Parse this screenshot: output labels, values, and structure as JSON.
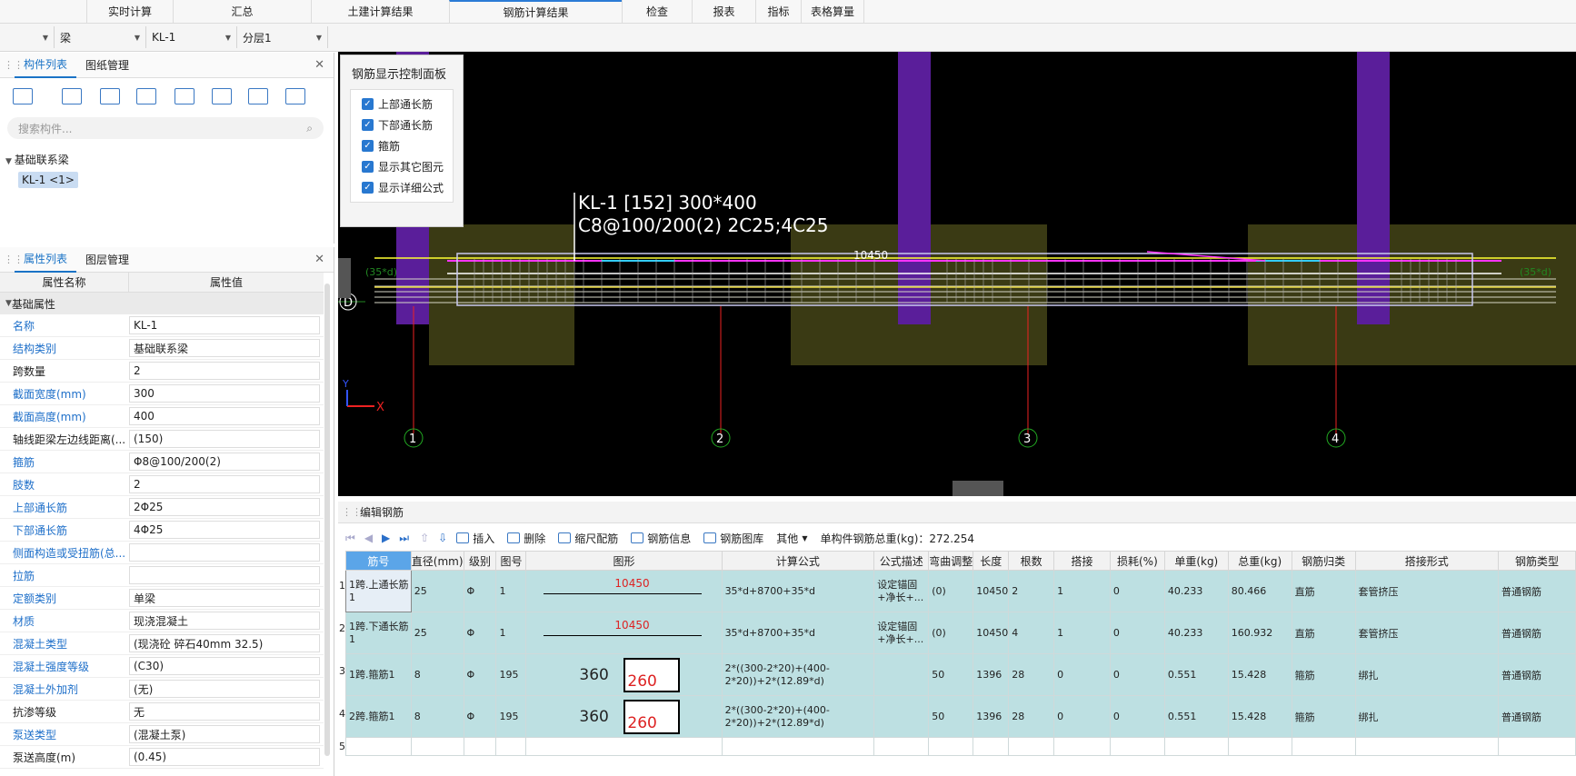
{
  "menu": [
    "实时计算",
    "汇总",
    "土建计算结果",
    "钢筋计算结果",
    "检查",
    "报表",
    "指标",
    "表格算量"
  ],
  "selectors": {
    "type": "梁",
    "member": "KL-1",
    "layer": "分层1"
  },
  "component_panel": {
    "tabs": [
      "构件列表",
      "图纸管理"
    ],
    "search_placeholder": "搜索构件...",
    "group": "基础联系梁",
    "item": "KL-1 <1>"
  },
  "property_panel": {
    "tabs": [
      "属性列表",
      "图层管理"
    ],
    "col_name": "属性名称",
    "col_value": "属性值",
    "section": "基础属性",
    "rows": [
      {
        "name": "名称",
        "value": "KL-1",
        "blue": true
      },
      {
        "name": "结构类别",
        "value": "基础联系梁",
        "blue": true
      },
      {
        "name": "跨数量",
        "value": "2",
        "blue": false
      },
      {
        "name": "截面宽度(mm)",
        "value": "300",
        "blue": true
      },
      {
        "name": "截面高度(mm)",
        "value": "400",
        "blue": true
      },
      {
        "name": "轴线距梁左边线距离(...",
        "value": "(150)",
        "blue": false
      },
      {
        "name": "箍筋",
        "value": "Φ8@100/200(2)",
        "blue": true
      },
      {
        "name": "肢数",
        "value": "2",
        "blue": true
      },
      {
        "name": "上部通长筋",
        "value": "2Φ25",
        "blue": true
      },
      {
        "name": "下部通长筋",
        "value": "4Φ25",
        "blue": true
      },
      {
        "name": "侧面构造或受扭筋(总...",
        "value": "",
        "blue": true
      },
      {
        "name": "拉筋",
        "value": "",
        "blue": true
      },
      {
        "name": "定额类别",
        "value": "单梁",
        "blue": true
      },
      {
        "name": "材质",
        "value": "现浇混凝土",
        "blue": true
      },
      {
        "name": "混凝土类型",
        "value": "(现浇砼 碎石40mm 32.5)",
        "blue": true
      },
      {
        "name": "混凝土强度等级",
        "value": "(C30)",
        "blue": true
      },
      {
        "name": "混凝土外加剂",
        "value": "(无)",
        "blue": true
      },
      {
        "name": "抗渗等级",
        "value": "无",
        "blue": false
      },
      {
        "name": "泵送类型",
        "value": "(混凝土泵)",
        "blue": true
      },
      {
        "name": "泵送高度(m)",
        "value": "(0.45)",
        "blue": false
      }
    ]
  },
  "control_panel": {
    "title": "钢筋显示控制面板",
    "items": [
      "上部通长筋",
      "下部通长筋",
      "箍筋",
      "显示其它图元",
      "显示详细公式"
    ]
  },
  "drawing": {
    "label1": "KL-1 [152] 300*400",
    "label2": "C8@100/200(2) 2C25;4C25",
    "length": "10450",
    "axis_letter": "D",
    "axes": [
      "1",
      "2",
      "3",
      "4"
    ],
    "anchor": "(35*d)"
  },
  "edit": {
    "title": "编辑钢筋",
    "tools": [
      "插入",
      "删除",
      "缩尺配筋",
      "钢筋信息",
      "钢筋图库",
      "其他"
    ],
    "total": "单构件钢筋总重(kg)：272.254"
  },
  "table": {
    "headers": [
      "筋号",
      "直径(mm)",
      "级别",
      "图号",
      "图形",
      "计算公式",
      "公式描述",
      "弯曲调整",
      "长度",
      "根数",
      "搭接",
      "损耗(%)",
      "单重(kg)",
      "总重(kg)",
      "钢筋归类",
      "搭接形式",
      "钢筋类型"
    ],
    "rows": [
      {
        "no": "1",
        "name": "1跨.上通长筋1",
        "dia": "25",
        "grade": "Φ",
        "fig": "1",
        "shape": "10450",
        "formula": "35*d+8700+35*d",
        "desc": "设定锚固+净长+...",
        "bend": "(0)",
        "len": "10450",
        "count": "2",
        "lap": "1",
        "loss": "0",
        "unit": "40.233",
        "total": "80.466",
        "cat": "直筋",
        "lapform": "套管挤压",
        "type": "普通钢筋"
      },
      {
        "no": "2",
        "name": "1跨.下通长筋1",
        "dia": "25",
        "grade": "Φ",
        "fig": "1",
        "shape": "10450",
        "formula": "35*d+8700+35*d",
        "desc": "设定锚固+净长+...",
        "bend": "(0)",
        "len": "10450",
        "count": "4",
        "lap": "1",
        "loss": "0",
        "unit": "40.233",
        "total": "160.932",
        "cat": "直筋",
        "lapform": "套管挤压",
        "type": "普通钢筋"
      },
      {
        "no": "3",
        "name": "1跨.箍筋1",
        "dia": "8",
        "grade": "Φ",
        "fig": "195",
        "shape_a": "360",
        "shape_b": "260",
        "formula": "2*((300-2*20)+(400-2*20))+2*(12.89*d)",
        "desc": "",
        "bend": "50",
        "len": "1396",
        "count": "28",
        "lap": "0",
        "loss": "0",
        "unit": "0.551",
        "total": "15.428",
        "cat": "箍筋",
        "lapform": "绑扎",
        "type": "普通钢筋"
      },
      {
        "no": "4",
        "name": "2跨.箍筋1",
        "dia": "8",
        "grade": "Φ",
        "fig": "195",
        "shape_a": "360",
        "shape_b": "260",
        "formula": "2*((300-2*20)+(400-2*20))+2*(12.89*d)",
        "desc": "",
        "bend": "50",
        "len": "1396",
        "count": "28",
        "lap": "0",
        "loss": "0",
        "unit": "0.551",
        "total": "15.428",
        "cat": "箍筋",
        "lapform": "绑扎",
        "type": "普通钢筋"
      }
    ]
  }
}
